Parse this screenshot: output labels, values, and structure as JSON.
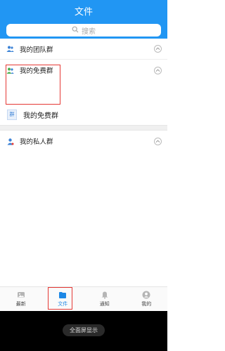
{
  "header": {
    "title": "文件"
  },
  "search": {
    "placeholder": "搜索"
  },
  "groups": {
    "team": {
      "label": "我的团队群"
    },
    "free": {
      "label": "我的免费群",
      "items": [
        {
          "icon_text": "群",
          "label": "我的免费群"
        }
      ]
    },
    "private": {
      "label": "我的私人群"
    }
  },
  "tabbar": {
    "tabs": [
      {
        "label": "最新",
        "icon": "image-icon"
      },
      {
        "label": "文件",
        "icon": "folder-icon",
        "active": true
      },
      {
        "label": "通知",
        "icon": "bell-icon"
      },
      {
        "label": "我的",
        "icon": "person-icon"
      }
    ]
  },
  "system": {
    "fullscreen_label": "全面屏显示"
  },
  "colors": {
    "primary": "#2196f3",
    "highlight": "#e53935",
    "group_icon_blue": "#3b82d6",
    "group_icon_green": "#4caf50"
  }
}
